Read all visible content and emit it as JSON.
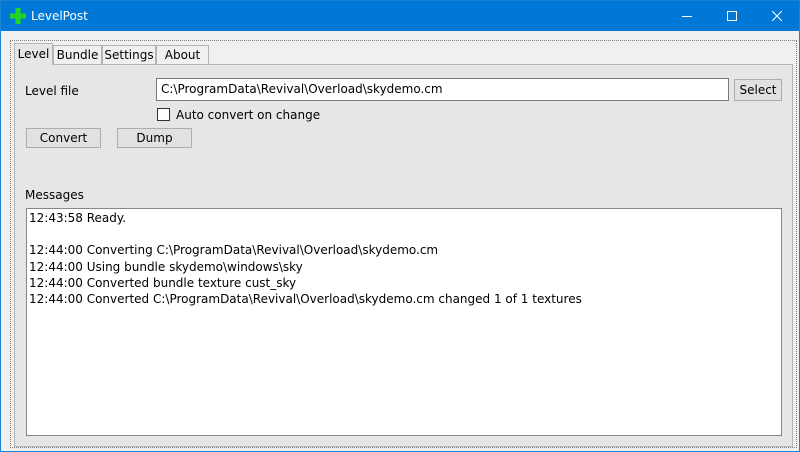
{
  "window": {
    "title": "LevelPost",
    "icon": "green-plus-icon",
    "accent_color": "#0078d7",
    "controls": [
      "minimize-icon",
      "maximize-icon",
      "close-icon"
    ]
  },
  "tabs": [
    {
      "label": "Level",
      "active": true
    },
    {
      "label": "Bundle",
      "active": false
    },
    {
      "label": "Settings",
      "active": false
    },
    {
      "label": "About",
      "active": false
    }
  ],
  "level": {
    "level_file_label": "Level file",
    "level_file_value": "C:\\ProgramData\\Revival\\Overload\\skydemo.cm",
    "select_button": "Select",
    "auto_convert_label": "Auto convert on change",
    "auto_convert_checked": false,
    "convert_button": "Convert",
    "dump_button": "Dump",
    "messages_label": "Messages",
    "messages": [
      "12:43:58 Ready.",
      "",
      "12:44:00 Converting C:\\ProgramData\\Revival\\Overload\\skydemo.cm",
      "12:44:00 Using bundle skydemo\\windows\\sky",
      "12:44:00 Converted bundle texture cust_sky",
      "12:44:00 Converted C:\\ProgramData\\Revival\\Overload\\skydemo.cm changed 1 of 1 textures"
    ]
  }
}
